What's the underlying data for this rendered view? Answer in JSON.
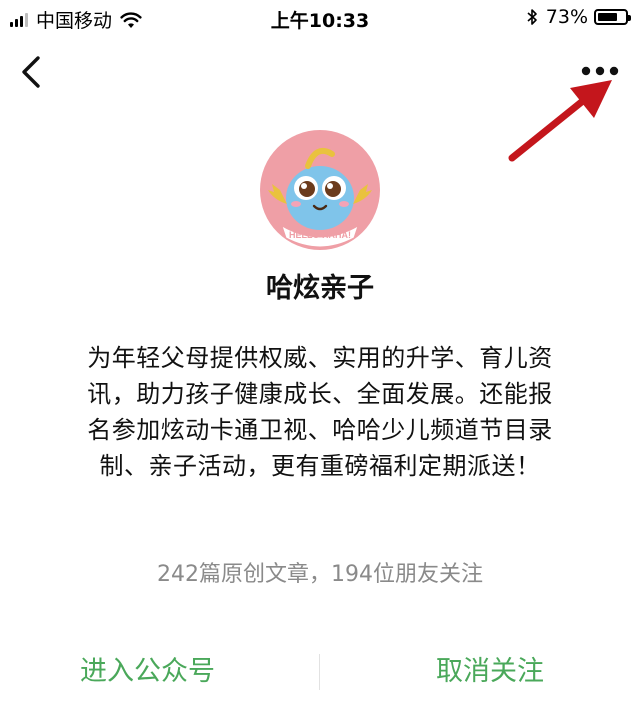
{
  "status_bar": {
    "carrier": "中国移动",
    "time": "上午10:33",
    "battery_percent": "73%",
    "battery_level": 0.73,
    "signal_bars": 3
  },
  "nav": {
    "back_icon": "chevron-left-icon",
    "more_icon": "more-dots-icon"
  },
  "profile": {
    "avatar_text": "HELLO HAHA!",
    "name": "哈炫亲子",
    "description": "为年轻父母提供权威、实用的升学、育儿资讯，助力孩子健康成长、全面发展。还能报名参加炫动卡通卫视、哈哈少儿频道节目录制、亲子活动，更有重磅福利定期派送！",
    "stats": "242篇原创文章，194位朋友关注"
  },
  "actions": {
    "enter_label": "进入公众号",
    "unfollow_label": "取消关注"
  },
  "colors": {
    "accent_green": "#4aa85a",
    "muted_gray": "#8a8a8a",
    "arrow_red": "#c4161c",
    "avatar_pink": "#ef9fa6",
    "mascot_blue": "#7fc4ea"
  }
}
